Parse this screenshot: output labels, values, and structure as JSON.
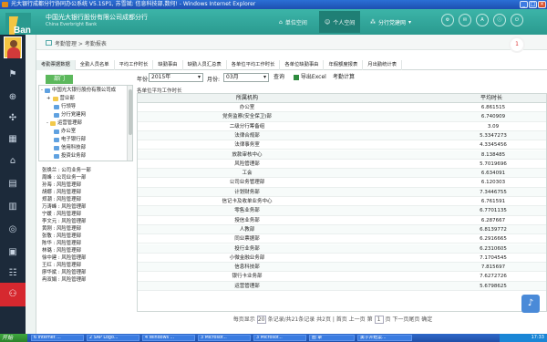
{
  "window": {
    "title": "光大银行成都分行协同办公系统 V5.1SP1, 苏雪斌: 信息科技部,数何! - Windows Internet Explorer",
    "controls": [
      "_",
      "□",
      "×"
    ]
  },
  "header": {
    "logo_name": "中国光大银行股份有限公司成都分行",
    "logo_sub": "China Everbright Bank",
    "brand_glyph": "Bank",
    "nav": [
      {
        "label": "单位空间",
        "icon": "home-icon"
      },
      {
        "label": "个人空间",
        "icon": "user-icon",
        "active": true
      },
      {
        "label": "分行党建网",
        "icon": "dots-icon"
      }
    ],
    "round_buttons": [
      "⚙",
      "✉",
      "A",
      "ⓘ",
      "⏻"
    ]
  },
  "breadcrumb": {
    "text": "考勤管理 > 考勤报表"
  },
  "badge": "1",
  "tabs": [
    {
      "label": "考勤票据数据",
      "active": true
    },
    {
      "label": "全勤人员名单"
    },
    {
      "label": "平均工作时长"
    },
    {
      "label": "缺勤事由"
    },
    {
      "label": "缺勤人员汇总表"
    },
    {
      "label": "各单位平均工作时长"
    },
    {
      "label": "各单位缺勤事由"
    },
    {
      "label": "年假额度报表"
    },
    {
      "label": "月出勤统计表"
    }
  ],
  "left_panel": {
    "dept_button": "部门",
    "tree": [
      {
        "label": "中国光大银行股份有限公司成",
        "indent": 0,
        "folder": "blue",
        "toggle": "-"
      },
      {
        "label": "营业部",
        "indent": 1,
        "folder": "yellow",
        "toggle": "+"
      },
      {
        "label": "行领导",
        "indent": 2,
        "folder": "blue",
        "toggle": ""
      },
      {
        "label": "分行党建网",
        "indent": 2,
        "folder": "blue",
        "toggle": ""
      },
      {
        "label": "运营管理部",
        "indent": 1,
        "folder": "yellow",
        "toggle": "-"
      },
      {
        "label": "办公室",
        "indent": 2,
        "folder": "blue",
        "toggle": ""
      },
      {
        "label": "电子银行部",
        "indent": 2,
        "folder": "blue",
        "toggle": ""
      },
      {
        "label": "信用科技部",
        "indent": 2,
        "folder": "blue",
        "toggle": ""
      },
      {
        "label": "投资业务部",
        "indent": 2,
        "folder": "blue",
        "toggle": ""
      }
    ],
    "users": [
      "张焕兰 : 公司业务一部",
      "周峰 : 公司业务一部",
      "孙海 : 风险管理部",
      "胡娜 : 风险管理部",
      "郑潮 : 风险管理部",
      "万涛峰 : 风险管理部",
      "宁媛 : 风险管理部",
      "李文元 : 风险管理部",
      "黄刚 : 风险管理部",
      "张敬 : 风险管理部",
      "陈华 : 风险管理部",
      "林璐 : 风险管理部",
      "徐中建 : 风险管理部",
      "王红 : 风险管理部",
      "廖华斌 : 风险管理部",
      "冉双娟 : 风险管理部"
    ]
  },
  "filters": {
    "year_label": "年份:",
    "year_value": "2015年",
    "month_label": "月份:",
    "month_value": "03月",
    "query_button": "查询",
    "export_button": "导出Excel",
    "stat_button": "考勤计算"
  },
  "table": {
    "caption": "各单位平均工作时长",
    "headers": [
      "所属机构",
      "平均时长"
    ],
    "rows": [
      {
        "org": "办公室",
        "val": "6.861515"
      },
      {
        "org": "党务监察(安全保卫)部",
        "val": "6.740909"
      },
      {
        "org": "二级分行筹备组",
        "val": "3.09"
      },
      {
        "org": "法律合规部",
        "val": "5.3347273"
      },
      {
        "org": "法律事务室",
        "val": "4.3345456"
      },
      {
        "org": "放款审核中心",
        "val": "8.138485"
      },
      {
        "org": "风险管理部",
        "val": "5.7019696"
      },
      {
        "org": "工会",
        "val": "6.634091"
      },
      {
        "org": "公司业务管理部",
        "val": "6.120303"
      },
      {
        "org": "计划财务部",
        "val": "7.3446755"
      },
      {
        "org": "信记卡及收单业务中心",
        "val": "6.761591"
      },
      {
        "org": "零售业务部",
        "val": "6.7701135"
      },
      {
        "org": "授信业务部",
        "val": "6.287667"
      },
      {
        "org": "人教部",
        "val": "6.8139772"
      },
      {
        "org": "同业票据部",
        "val": "6.2916665"
      },
      {
        "org": "投行业务部",
        "val": "6.2310605"
      },
      {
        "org": "小微金融业务部",
        "val": "7.1704545"
      },
      {
        "org": "信息科技部",
        "val": "7.815697"
      },
      {
        "org": "银行卡业务部",
        "val": "7.6272726"
      },
      {
        "org": "运营管理部",
        "val": "5.6798625"
      }
    ]
  },
  "pager": {
    "prefix": "每页显示",
    "page_size": "20",
    "text": "条记录/共21条记录 共2页 | 首页 上一页 第",
    "current": "1",
    "suffix": "页 下一页尾页 确定"
  },
  "taskbar": {
    "start": "开始",
    "tasks": [
      "6 Internet ...",
      "2 SAP Logo...",
      "4 Windows ...",
      "3 Microsof...",
      "3 Microsof...",
      "图 录",
      "美于开始菜..."
    ],
    "clock": "17:33"
  }
}
